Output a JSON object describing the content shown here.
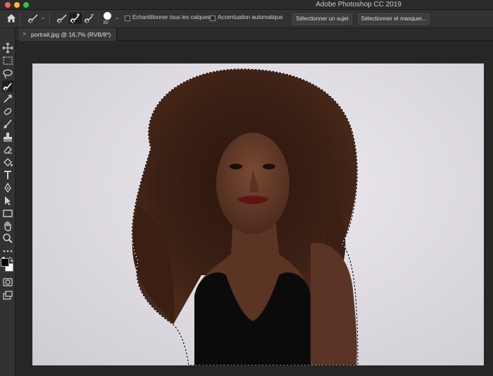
{
  "window": {
    "title": "Adobe Photoshop CC 2019",
    "traffic_colors": [
      "#fe5f57",
      "#febc2e",
      "#28c840"
    ]
  },
  "options_bar": {
    "brush_size": "30",
    "sample_all_layers_label": "Echantillonner tous les calques",
    "auto_enhance_label": "Accentuation automatique",
    "select_subject_label": "Sélectionner un sujet",
    "select_and_mask_label": "Sélectionner et masquer..."
  },
  "document": {
    "tab_label": "portrait.jpg @ 16,7% (RVB/8*)",
    "close_glyph": "×"
  },
  "toolbar": {
    "tools": [
      "move-icon",
      "marquee-icon",
      "lasso-icon",
      "quick-selection-icon",
      "eyedropper-icon",
      "healing-brush-icon",
      "brush-icon",
      "clone-stamp-icon",
      "eraser-icon",
      "paint-bucket-icon",
      "type-icon",
      "pen-icon",
      "path-selection-icon",
      "rectangle-icon",
      "hand-icon",
      "zoom-icon",
      "more-tools-icon"
    ],
    "foreground_color": "#000000",
    "background_color": "#ffffff"
  },
  "colors": {
    "ui_dark": "#323232",
    "canvas_bg": "#262626"
  }
}
